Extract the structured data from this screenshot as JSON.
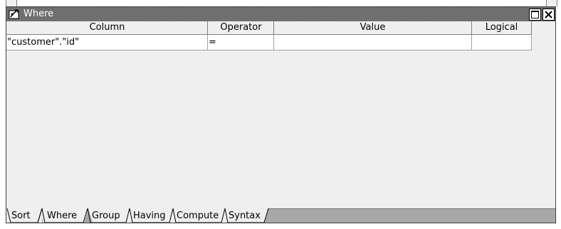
{
  "window": {
    "title": "Where"
  },
  "grid": {
    "columns": [
      "Column",
      "Operator",
      "Value",
      "Logical"
    ],
    "rows": [
      {
        "column": "\"customer\".\"id\"",
        "operator": "=",
        "value": "",
        "logical": ""
      }
    ]
  },
  "tabs": [
    {
      "label": "Sort",
      "active": false
    },
    {
      "label": "Where",
      "active": true
    },
    {
      "label": "Group",
      "active": false
    },
    {
      "label": "Having",
      "active": false
    },
    {
      "label": "Compute",
      "active": false
    },
    {
      "label": "Syntax",
      "active": false
    }
  ],
  "colors": {
    "titlebar": "#6a6a6a",
    "body": "#efefef",
    "tabbar": "#a8a8a8"
  }
}
